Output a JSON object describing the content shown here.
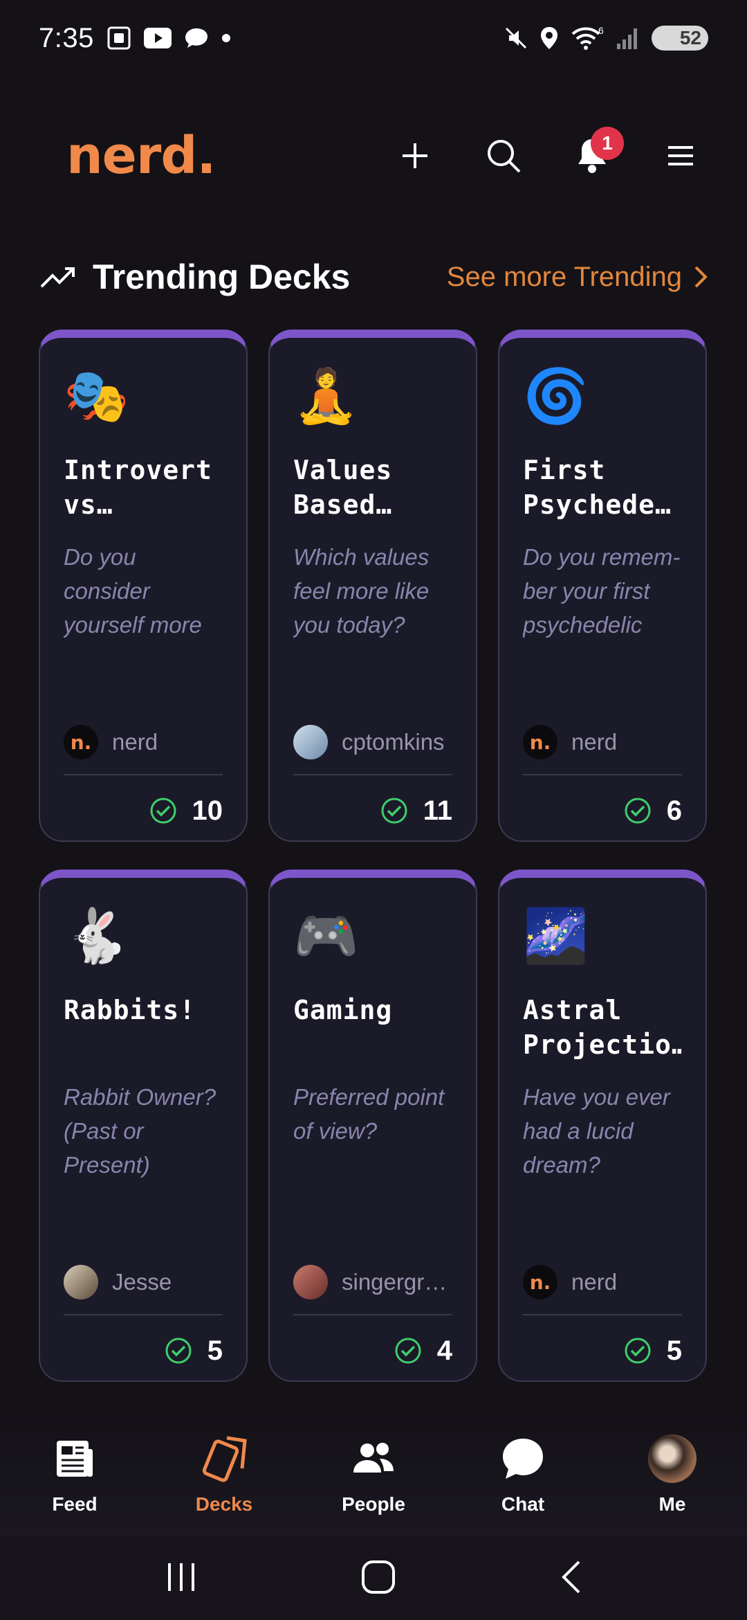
{
  "status_bar": {
    "time": "7:35",
    "wifi_badge": "6",
    "battery": "52"
  },
  "header": {
    "logo": "nerd.",
    "notification_count": "1"
  },
  "section": {
    "title": "Trending Decks",
    "see_more": "See more Trending"
  },
  "decks": [
    {
      "emoji": "🎭",
      "title": "Introvert vs…",
      "prompt": "Do you consider yourself more of an introvert?",
      "author": "nerd",
      "avatar_type": "nerd",
      "count": "10"
    },
    {
      "emoji": "🧘",
      "title": "Values Based…",
      "prompt": "Which values feel more like you today?",
      "author": "cptomkins",
      "avatar_type": "cptomkins",
      "count": "11"
    },
    {
      "emoji": "🌀",
      "title": "First Psychede…",
      "prompt": "Do you remem-ber your first psychedelic e…",
      "author": "nerd",
      "avatar_type": "nerd",
      "count": "6"
    },
    {
      "emoji": "🐇",
      "title": "Rabbits!",
      "prompt": "Rabbit Owner? (Past or Present)",
      "author": "Jesse",
      "avatar_type": "jesse",
      "count": "5"
    },
    {
      "emoji": "🎮",
      "title": "Gaming",
      "prompt": "Preferred point of view?",
      "author": "singergr…",
      "avatar_type": "singer",
      "count": "4"
    },
    {
      "emoji": "🌌",
      "title": "Astral Projectio…",
      "prompt": "Have you ever had a lucid dream?",
      "author": "nerd",
      "avatar_type": "nerd",
      "count": "5"
    }
  ],
  "nav": {
    "feed": "Feed",
    "decks": "Decks",
    "people": "People",
    "chat": "Chat",
    "me": "Me"
  },
  "colors": {
    "accent": "#f0894a",
    "card_top_bar": "#7c56c9",
    "check_green": "#3fcf6b",
    "badge_red": "#e1344a"
  }
}
